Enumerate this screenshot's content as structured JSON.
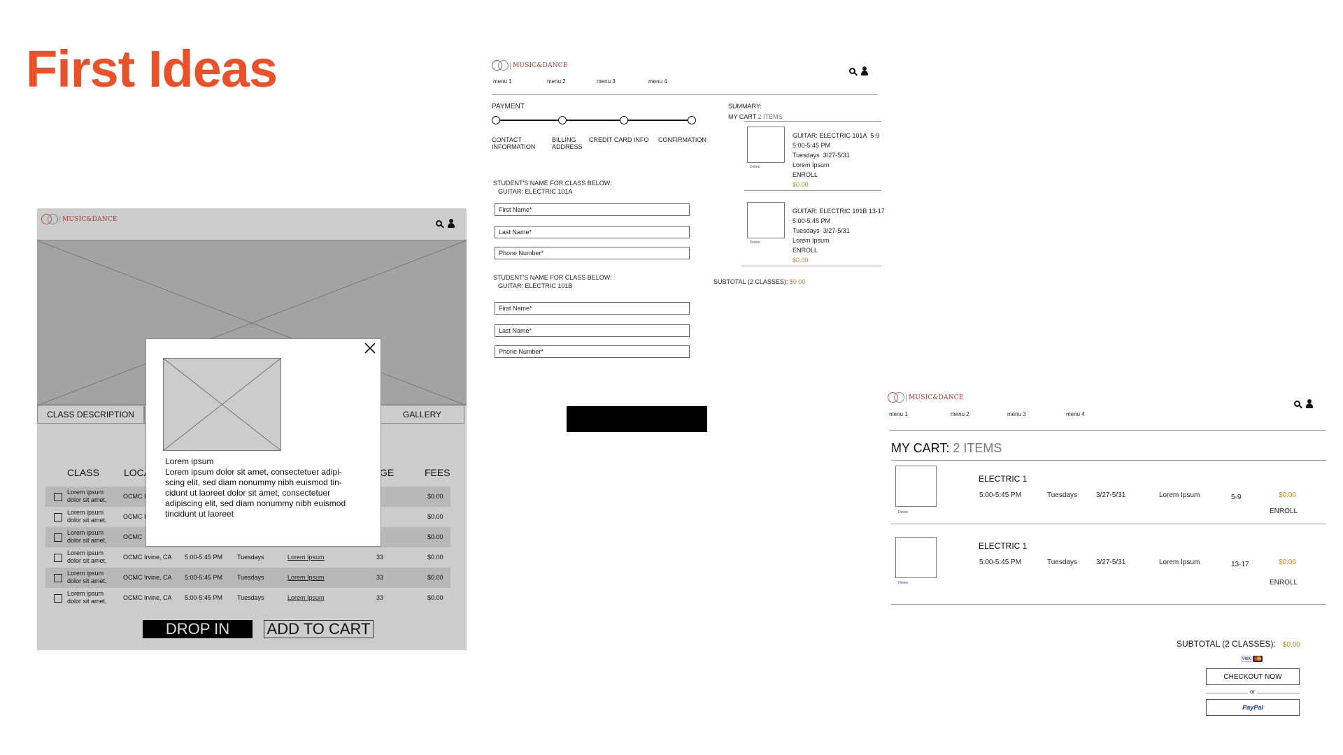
{
  "page_title": "First Ideas",
  "brand": {
    "logo_text": "MUSIC&DANCE",
    "accent_color": "#e8512a",
    "price_color": "#b8872e"
  },
  "menu": [
    "menu 1",
    "menu 2",
    "menu 3",
    "menu 4"
  ],
  "class_page": {
    "tabs": [
      "CLASS DESCRIPTION",
      "GALLERY"
    ],
    "table_headers": [
      "CLASS",
      "LOCA",
      "GE",
      "FEES"
    ],
    "rows": [
      {
        "class": "Lorem ipsum dolor sit amet,",
        "location": "OCMC I",
        "time": "",
        "day": "",
        "link": "",
        "age": "3",
        "fee": "$0.00"
      },
      {
        "class": "Lorem ipsum dolor sit amet,",
        "location": "OCMC I",
        "time": "",
        "day": "",
        "link": "",
        "age": "3",
        "fee": "$0.00"
      },
      {
        "class": "Lorem ipsum dolor sit amet,",
        "location": "OCMC",
        "time": "",
        "day": "",
        "link": "",
        "age": "3",
        "fee": "$0.00"
      },
      {
        "class": "Lorem ipsum dolor sit amet,",
        "location": "OCMC Irvine, CA",
        "time": "5:00-5:45 PM",
        "day": "Tuesdays",
        "link": "Lorem Ipsum",
        "age": "33",
        "fee": "$0.00"
      },
      {
        "class": "Lorem ipsum dolor sit amet,",
        "location": "OCMC Irvine, CA",
        "time": "5:00-5:45 PM",
        "day": "Tuesdays",
        "link": "Lorem Ipsum",
        "age": "33",
        "fee": "$0.00"
      },
      {
        "class": "Lorem ipsum dolor sit amet,",
        "location": "OCMC Irvine, CA",
        "time": "5:00-5:45 PM",
        "day": "Tuesdays",
        "link": "Lorem Ipsum",
        "age": "33",
        "fee": "$0.00"
      }
    ],
    "drop_in_label": "DROP IN",
    "add_to_cart_label": "ADD TO CART",
    "modal": {
      "title": "Lorem ipsum",
      "body": "Lorem ipsum dolor sit amet, consectetuer adipi-scing elit, sed diam nonummy nibh euismod tin-cidunt ut laoreet dolor sit amet, consectetuer adipiscing elit, sed diam nonummy nibh euismod tincidunt ut laoreet"
    }
  },
  "payment_page": {
    "heading": "PAYMENT",
    "steps": [
      "CONTACT INFORMATION",
      "BILLING ADDRESS",
      "CREDIT CARD INFO",
      "CONFIRMATION"
    ],
    "student_sections": [
      {
        "label": "STUDENT'S NAME FOR CLASS BELOW:",
        "class_name": "GUITAR: ELECTRIC 101A"
      },
      {
        "label": "STUDENT'S NAME FOR CLASS BELOW:",
        "class_name": "GUITAR: ELECTRIC 101B"
      }
    ],
    "fields": [
      "First Name*",
      "Last Name*",
      "Phone Number*"
    ],
    "summary": {
      "heading": "SUMMARY:",
      "cart_label": "MY CART",
      "cart_count": "2 ITEMS",
      "items": [
        {
          "title": "GUITAR: ELECTRIC 101A",
          "age": "5-9",
          "time": "5:00-5:45 PM",
          "day": "Tuesdays",
          "dates": "3/27-5/31",
          "instructor": "Lorem Ipsum",
          "type": "ENROLL",
          "price": "$0.00",
          "delete": "Delete"
        },
        {
          "title": "GUITAR: ELECTRIC 101B",
          "age": "13-17",
          "time": "5:00-5:45 PM",
          "day": "Tuesdays",
          "dates": "3/27-5/31",
          "instructor": "Lorem Ipsum",
          "type": "ENROLL",
          "price": "$0.00",
          "delete": "Delete"
        }
      ],
      "subtotal_label": "SUBTOTAL (2 CLASSES):",
      "subtotal_value": "$0.00"
    }
  },
  "cart_page": {
    "title_prefix": "MY CART:",
    "title_count": "2 ITEMS",
    "items": [
      {
        "title": "ELECTRIC 1",
        "time": "5:00-5:45 PM",
        "day": "Tuesdays",
        "dates": "3/27-5/31",
        "instructor": "Lorem Ipsum",
        "age": "5-9",
        "price": "$0.00",
        "type": "ENROLL",
        "delete": "Delete"
      },
      {
        "title": "ELECTRIC 1",
        "time": "5:00-5:45 PM",
        "day": "Tuesdays",
        "dates": "3/27-5/31",
        "instructor": "Lorem Ipsum",
        "age": "13-17",
        "price": "$0.00",
        "type": "ENROLL",
        "delete": "Delete"
      }
    ],
    "subtotal_label": "SUBTOTAL (2 CLASSES):",
    "subtotal_value": "$0.00",
    "checkout_label": "CHECKOUT NOW",
    "or_label": "or",
    "paypal_label": "PayPal",
    "card_labels": [
      "VISA"
    ]
  }
}
